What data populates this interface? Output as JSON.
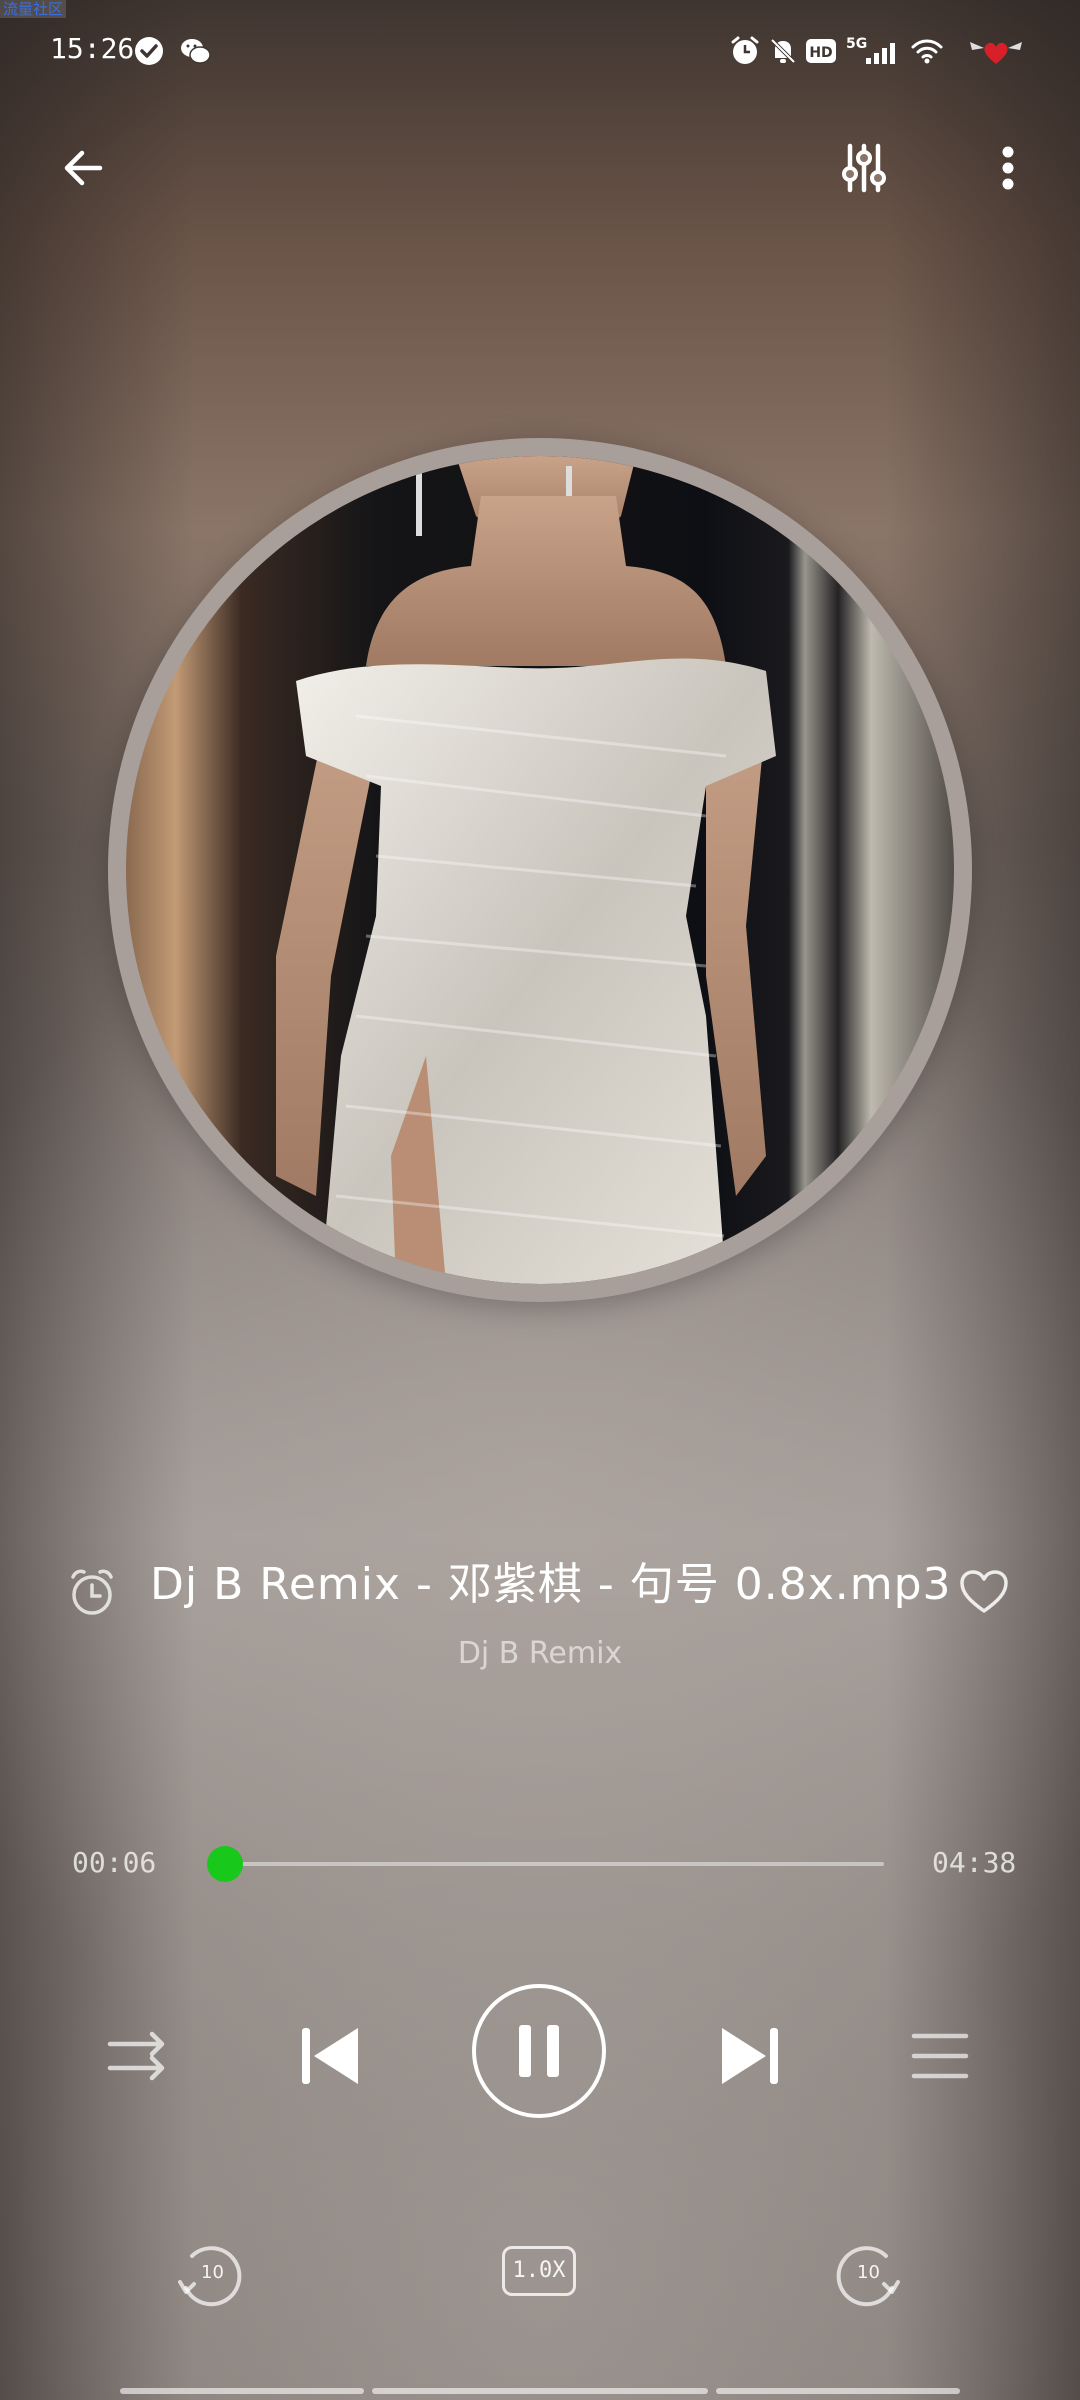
{
  "corner_label": "流量社区",
  "status_bar": {
    "time": "15:26",
    "icons": [
      "check-circle-icon",
      "wechat-icon",
      "alarm-icon",
      "bell-off-icon",
      "hd-icon",
      "5g-signal-icon",
      "wifi-icon",
      "heart-wings-icon"
    ],
    "network": "5G",
    "hd": "HD"
  },
  "header": {
    "back_icon": "back-arrow-icon",
    "equalizer_icon": "equalizer-icon",
    "more_icon": "more-vert-icon"
  },
  "track": {
    "title": "Dj B Remix - 邓紫棋 - 句号 0.8x.mp3",
    "artist": "Dj B Remix",
    "favorite": false
  },
  "progress": {
    "current": "00:06",
    "total": "04:38",
    "fraction": 0.022
  },
  "controls": {
    "repeat_icon": "repeat-icon",
    "previous_icon": "skip-previous-icon",
    "play_state": "playing",
    "next_icon": "skip-next-icon",
    "playlist_icon": "playlist-icon"
  },
  "extras": {
    "rewind_seconds": "10",
    "speed": "1.0X",
    "forward_seconds": "10"
  },
  "colors": {
    "accent": "#18c81a",
    "corner_label": "#3a6fe0"
  }
}
